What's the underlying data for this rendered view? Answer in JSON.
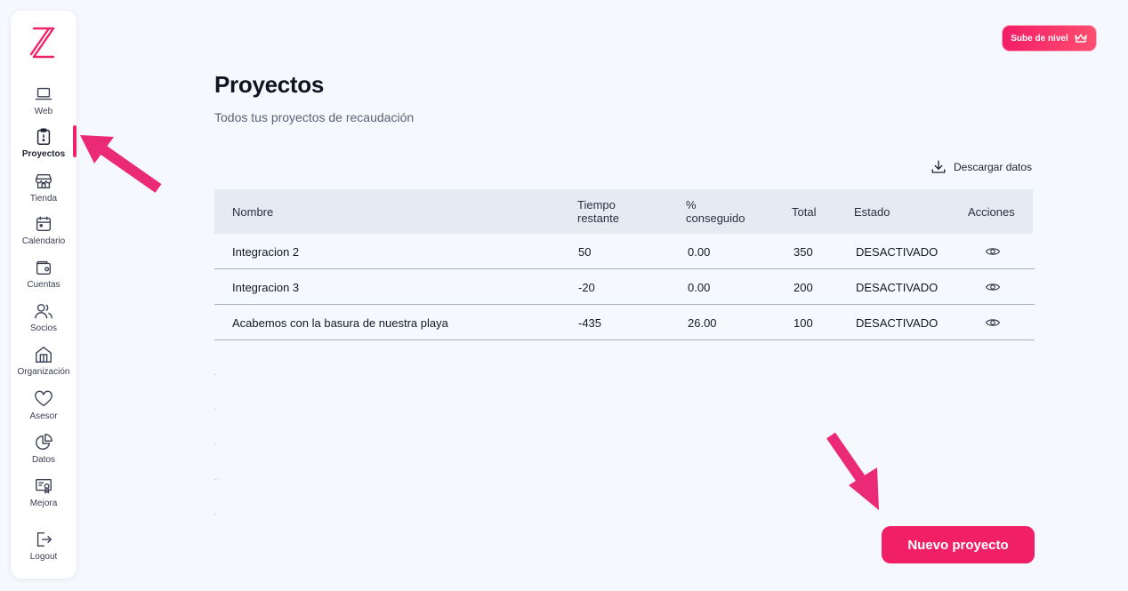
{
  "sidebar": {
    "items": [
      {
        "label": "Web",
        "icon": "laptop-icon"
      },
      {
        "label": "Proyectos",
        "icon": "clipboard-icon"
      },
      {
        "label": "Tienda",
        "icon": "store-icon"
      },
      {
        "label": "Calendario",
        "icon": "calendar-icon"
      },
      {
        "label": "Cuentas",
        "icon": "wallet-icon"
      },
      {
        "label": "Socios",
        "icon": "users-icon"
      },
      {
        "label": "Organización",
        "icon": "building-icon"
      },
      {
        "label": "Asesor",
        "icon": "heart-icon"
      },
      {
        "label": "Datos",
        "icon": "pie-chart-icon"
      },
      {
        "label": "Mejora",
        "icon": "certificate-icon"
      },
      {
        "label": "Logout",
        "icon": "logout-icon"
      }
    ],
    "active": "Proyectos"
  },
  "header": {
    "upgrade_label": "Sube de nivel",
    "title": "Proyectos",
    "subtitle": "Todos tus proyectos de recaudación"
  },
  "download_label": "Descargar datos",
  "table": {
    "columns": {
      "nombre": "Nombre",
      "tiempo_1": "Tiempo",
      "tiempo_2": "restante",
      "pct_1": "%",
      "pct_2": "conseguido",
      "total": "Total",
      "estado": "Estado",
      "acciones": "Acciones"
    },
    "rows": [
      {
        "nombre": "Integracion 2",
        "tiempo": "50",
        "pct": "0.00",
        "total": "350",
        "estado": "DESACTIVADO"
      },
      {
        "nombre": "Integracion 3",
        "tiempo": "-20",
        "pct": "0.00",
        "total": "200",
        "estado": "DESACTIVADO"
      },
      {
        "nombre": "Acabemos con la basura de nuestra playa",
        "tiempo": "-435",
        "pct": "26.00",
        "total": "100",
        "estado": "DESACTIVADO"
      }
    ]
  },
  "new_project_label": "Nuevo proyecto",
  "colors": {
    "accent": "#f01f66",
    "background": "#f5f8fd",
    "table_header": "#e6eaf3"
  }
}
